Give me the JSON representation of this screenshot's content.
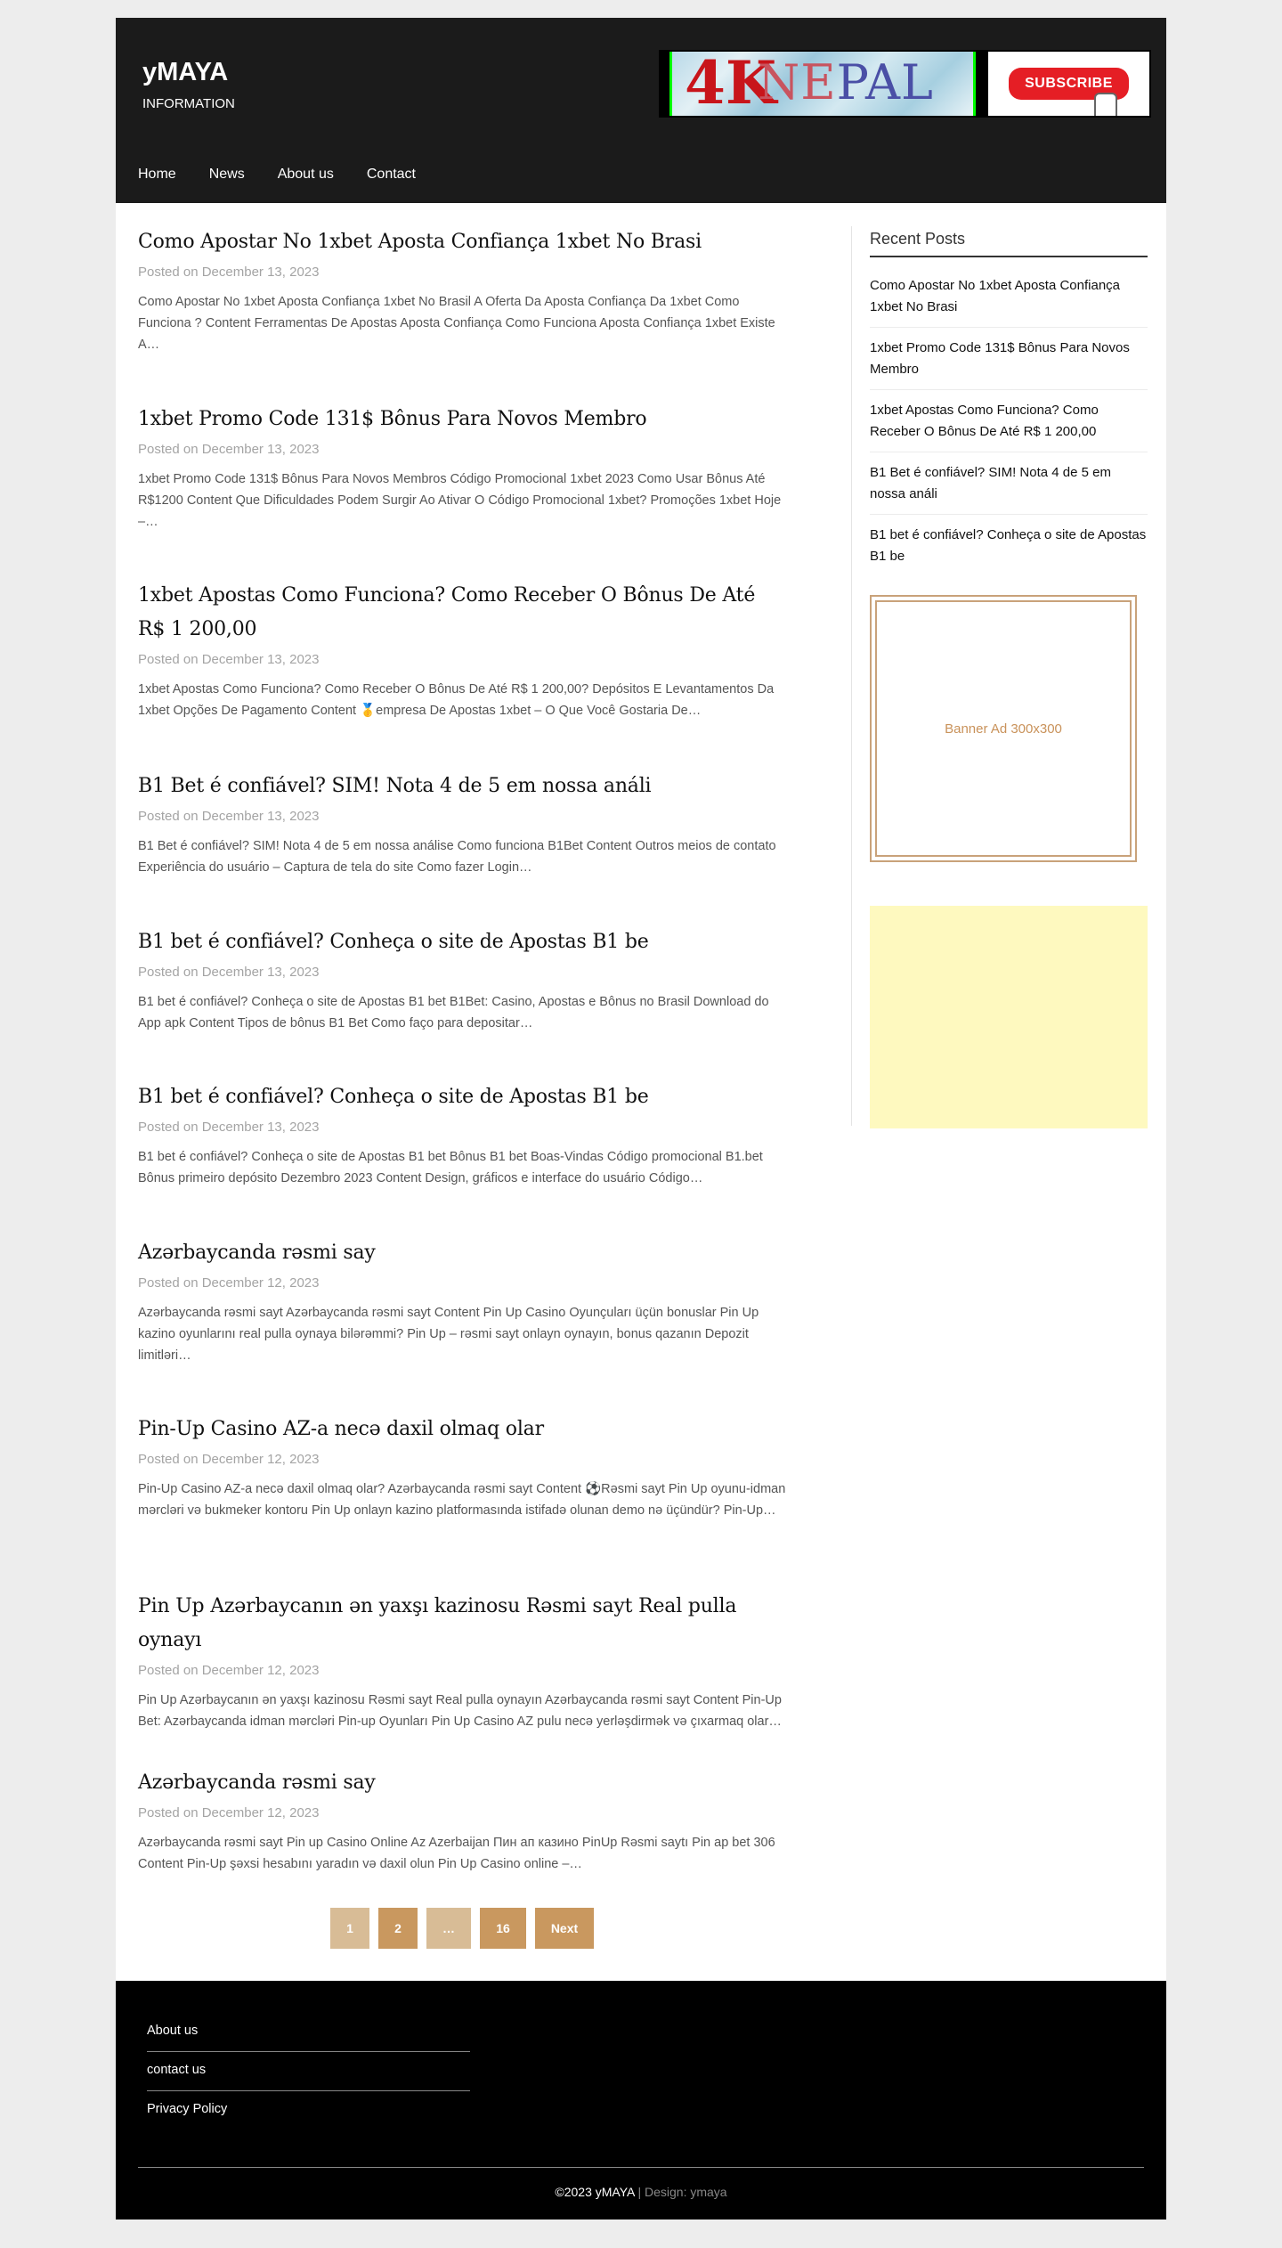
{
  "site": {
    "title": "yMAYA",
    "tagline": "INFORMATION"
  },
  "header_banner": {
    "left_text_4k": "4K",
    "left_text_nepal_a": "NE",
    "left_text_nepal_b": "PAL",
    "subscribe_label": "SUBSCRIBE"
  },
  "nav": [
    "Home",
    "News",
    "About us",
    "Contact"
  ],
  "posts": [
    {
      "title": "Como Apostar No 1xbet Aposta Confiança 1xbet No Brasi",
      "date": "Posted on December 13, 2023",
      "excerpt": "Como Apostar No 1xbet Aposta Confiança 1xbet No Brasil A Oferta Da Aposta Confiança Da 1xbet Como Funciona ? Content Ferramentas De Apostas Aposta Confiança Como Funciona Aposta Confiança 1xbet Existe A…"
    },
    {
      "title": "1xbet Promo Code 131$ Bônus Para Novos Membro",
      "date": "Posted on December 13, 2023",
      "excerpt": "1xbet Promo Code 131$ Bônus Para Novos Membros Código Promocional 1xbet 2023 Como Usar Bônus Até R$1200 Content Que Dificuldades Podem Surgir Ao Ativar O Código Promocional 1xbet? Promoções 1xbet Hoje –…"
    },
    {
      "title": "1xbet Apostas Como Funciona? Como Receber O Bônus De Até R$ 1 200,00",
      "date": "Posted on December 13, 2023",
      "excerpt": "1xbet Apostas Como Funciona? Como Receber O Bônus De Até R$ 1 200,00? Depósitos E Levantamentos Da 1xbet Opções De Pagamento Content 🥇empresa De Apostas 1xbet – O Que Você Gostaria De…"
    },
    {
      "title": "B1 Bet é confiável? SIM! Nota 4 de 5 em nossa análi",
      "date": "Posted on December 13, 2023",
      "excerpt": "B1 Bet é confiável? SIM! Nota 4 de 5 em nossa análise Como funciona B1Bet Content Outros meios de contato Experiência do usuário – Captura de tela do site Como fazer Login…"
    },
    {
      "title": "B1 bet é confiável? Conheça o site de Apostas B1 be",
      "date": "Posted on December 13, 2023",
      "excerpt": "B1 bet é confiável? Conheça o site de Apostas B1 bet B1Bet: Casino, Apostas e Bônus no Brasil Download do App apk Content Tipos de bônus B1 Bet Como faço para depositar…"
    },
    {
      "title": "B1 bet é confiável? Conheça o site de Apostas B1 be",
      "date": "Posted on December 13, 2023",
      "excerpt": "B1 bet é confiável? Conheça o site de Apostas B1 bet Bônus B1 bet Boas-Vindas  Código promocional B1.bet Bônus primeiro depósito Dezembro 2023 Content Design, gráficos e interface do usuário Código…"
    },
    {
      "title": "Azərbaycanda rəsmi say",
      "date": "Posted on December 12, 2023",
      "excerpt": "Azərbaycanda rəsmi sayt Azərbaycanda rəsmi sayt Content Pin Up Casino Oyunçuları üçün bonuslar Pin Up kazino oyunlarını real pulla oynaya bilərəmmi? Pin Up – rəsmi sayt onlayn oynayın, bonus qazanın Depozit limitləri…"
    },
    {
      "title": "Pin-Up Casino AZ-a necə daxil olmaq olar",
      "date": "Posted on December 12, 2023",
      "excerpt": "Pin-Up Casino AZ-a necə daxil olmaq olar? Azərbaycanda rəsmi sayt Content ⚽Rəsmi sayt Pin Up oyunu-idman mərcləri və bukmeker kontoru Pin Up onlayn kazino platformasında istifadə olunan demo nə üçündür? Pin-Up…"
    },
    {
      "title": "Pin Up Azərbaycanın ən yaxşı kazinosu Rəsmi sayt Real pulla oynayı",
      "date": "Posted on December 12, 2023",
      "excerpt": "Pin Up Azərbaycanın ən yaxşı kazinosu Rəsmi sayt Real pulla oynayın Azərbaycanda rəsmi sayt Content Pin-Up Bet: Azərbaycanda idman mərcləri Pin-up Oyunları Pin Up Casino AZ pulu necə yerləşdirmək və çıxarmaq olar…"
    },
    {
      "title": "Azərbaycanda rəsmi say",
      "date": "Posted on December 12, 2023",
      "excerpt": "Azərbaycanda rəsmi sayt Pin up Casino Online Az Azerbaijan Пин ап казино PinUp Rəsmi saytı Pin ap bet 306 Content Pin-Up şəxsi hesabını yaradın və daxil olun Pin Up Casino online –…"
    }
  ],
  "pagination": {
    "items": [
      "1",
      "2",
      "…",
      "16",
      "Next"
    ]
  },
  "sidebar": {
    "recent_title": "Recent Posts",
    "recent": [
      "Como Apostar No 1xbet Aposta Confiança 1xbet No Brasi",
      "1xbet Promo Code 131$ Bônus Para Novos Membro",
      "1xbet Apostas Como Funciona? Como Receber O Bônus De Até R$ 1 200,00",
      "B1 Bet é confiável? SIM! Nota 4 de 5 em nossa análi",
      "B1 bet é confiável? Conheça o site de Apostas B1 be"
    ],
    "ad_label": "Banner Ad 300x300"
  },
  "footer": {
    "links": [
      "About us",
      "contact us",
      "Privacy Policy"
    ],
    "copyright": "©2023 yMAYA",
    "design_sep": " | ",
    "design": "Design: ymaya"
  },
  "colors": {
    "header_bg": "#1b1b1b",
    "accent": "#c9985f",
    "accent_light": "#d8bc96",
    "footer_bg": "#000000",
    "yellow_box": "#fef9bf"
  }
}
